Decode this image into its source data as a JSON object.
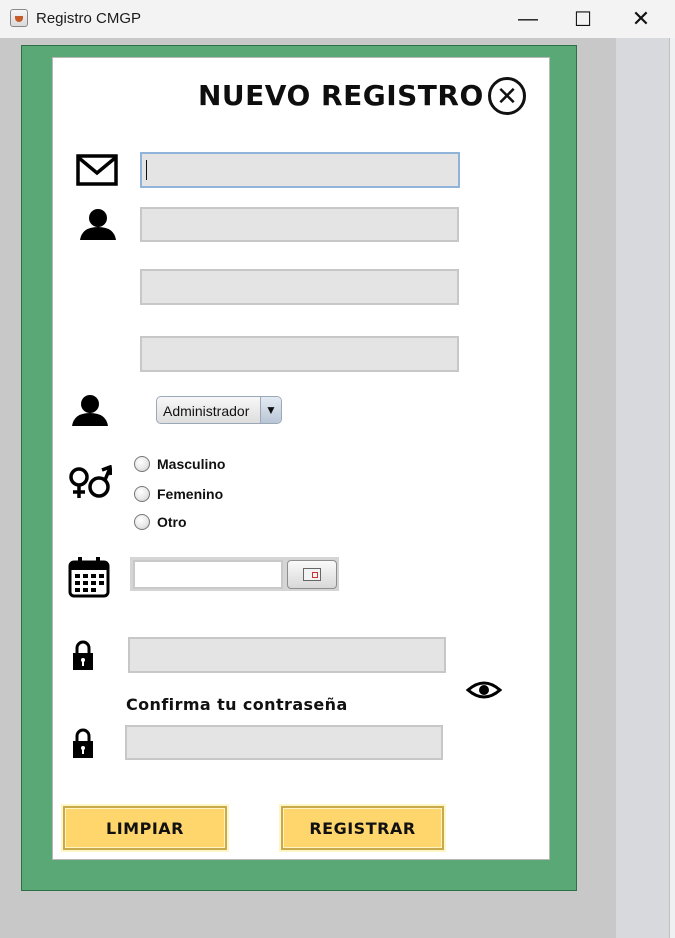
{
  "window": {
    "title": "Registro CMGP",
    "minimize": "—",
    "maximize": "☐",
    "close": "✕"
  },
  "form": {
    "heading": "NUEVO REGISTRO",
    "close_glyph": "✕",
    "email_value": "",
    "name_value": "",
    "field2_value": "",
    "field3_value": "",
    "role_selected": "Administrador",
    "gender_options": [
      "Masculino",
      "Femenino",
      "Otro"
    ],
    "date_value": "",
    "password_value": "",
    "confirm_label": "Confirma tu contraseña",
    "confirm_value": "",
    "clear_button": "LIMPIAR",
    "register_button": "REGISTRAR"
  },
  "icons": {
    "email": "envelope-icon",
    "user": "user-icon",
    "role": "user-icon",
    "gender": "gender-icon",
    "date": "calendar-icon",
    "lock": "lock-icon",
    "show_password": "eye-icon",
    "close": "close-circle-icon"
  },
  "colors": {
    "panel_green": "#5aa875",
    "button_yellow": "#ffd66b",
    "field_gray": "#e4e4e4"
  }
}
